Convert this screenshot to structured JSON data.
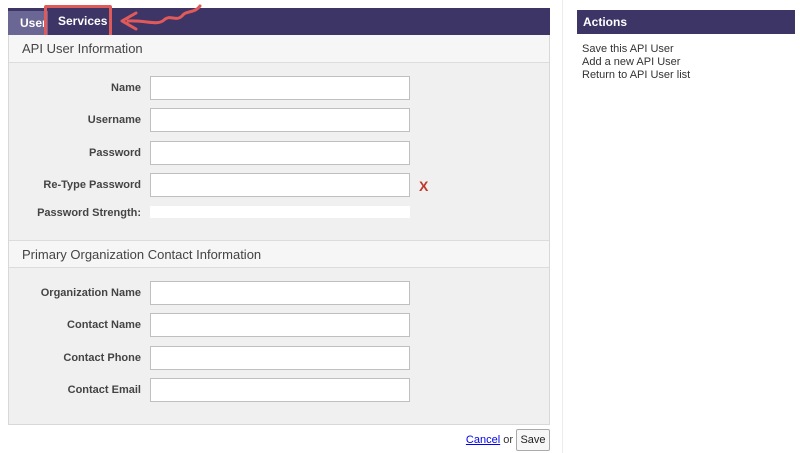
{
  "tabs": [
    {
      "label": "User"
    },
    {
      "label": "Services"
    }
  ],
  "sections": {
    "api_user_info": {
      "title": "API User Information",
      "fields": {
        "name": {
          "label": "Name",
          "value": ""
        },
        "username": {
          "label": "Username",
          "value": ""
        },
        "password": {
          "label": "Password",
          "value": ""
        },
        "retype_password": {
          "label": "Re-Type Password",
          "value": "",
          "error_mark": "X"
        },
        "password_strength": {
          "label": "Password Strength:"
        }
      }
    },
    "primary_contact": {
      "title": "Primary Organization Contact Information",
      "fields": {
        "org_name": {
          "label": "Organization Name",
          "value": ""
        },
        "contact_name": {
          "label": "Contact Name",
          "value": ""
        },
        "contact_phone": {
          "label": "Contact Phone",
          "value": ""
        },
        "contact_email": {
          "label": "Contact Email",
          "value": ""
        }
      }
    }
  },
  "footer": {
    "cancel_label": "Cancel",
    "or_text": "or",
    "save_label": "Save"
  },
  "sidebar": {
    "header": "Actions",
    "items": [
      {
        "label": "Save this API User"
      },
      {
        "label": "Add a new API User"
      },
      {
        "label": "Return to API User list"
      }
    ]
  },
  "colors": {
    "brand": "#3c3566",
    "highlight": "#e15a5a",
    "error": "#c0392b"
  }
}
